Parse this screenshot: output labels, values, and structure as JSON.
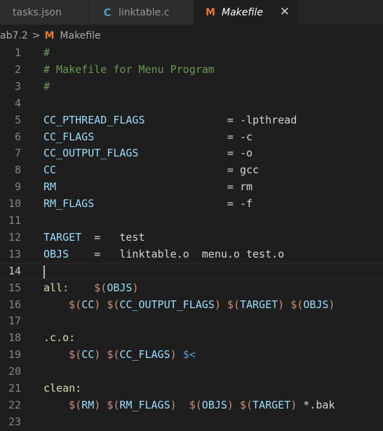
{
  "tabs": [
    {
      "label": "tasks.json",
      "icon": "json-file-icon"
    },
    {
      "label": "linktable.c",
      "icon": "c-file-icon",
      "icon_glyph": "C"
    },
    {
      "label": "Makefile",
      "icon": "makefile-icon",
      "icon_glyph": "M",
      "active": true
    }
  ],
  "breadcrumb": {
    "folder": "ab7.2",
    "separator": ">",
    "file_icon_glyph": "M",
    "file": "Makefile"
  },
  "colors": {
    "background": "#1e1e1e",
    "comment": "#6a9955",
    "variable": "#9cdcfe",
    "sigil": "#ce9178",
    "makefile_icon": "#e37933",
    "c_icon": "#519aba"
  },
  "editor": {
    "current_line": 14,
    "lines": [
      {
        "n": "1",
        "t": "#"
      },
      {
        "n": "2",
        "t": "# Makefile for Menu Program"
      },
      {
        "n": "3",
        "t": "#"
      },
      {
        "n": "4",
        "t": ""
      },
      {
        "n": "5",
        "t": "CC_PTHREAD_FLAGS             = -lpthread"
      },
      {
        "n": "6",
        "t": "CC_FLAGS                     = -c"
      },
      {
        "n": "7",
        "t": "CC_OUTPUT_FLAGS              = -o"
      },
      {
        "n": "8",
        "t": "CC                           = gcc"
      },
      {
        "n": "9",
        "t": "RM                           = rm"
      },
      {
        "n": "10",
        "t": "RM_FLAGS                     = -f"
      },
      {
        "n": "11",
        "t": ""
      },
      {
        "n": "12",
        "t": "TARGET  =   test"
      },
      {
        "n": "13",
        "t": "OBJS    =   linktable.o  menu.o test.o"
      },
      {
        "n": "14",
        "t": ""
      },
      {
        "n": "15",
        "t": "all:    $(OBJS)"
      },
      {
        "n": "16",
        "t": "    $(CC) $(CC_OUTPUT_FLAGS) $(TARGET) $(OBJS)"
      },
      {
        "n": "17",
        "t": ""
      },
      {
        "n": "18",
        "t": ".c.o:"
      },
      {
        "n": "19",
        "t": "    $(CC) $(CC_FLAGS) $<"
      },
      {
        "n": "20",
        "t": ""
      },
      {
        "n": "21",
        "t": "clean:"
      },
      {
        "n": "22",
        "t": "    $(RM) $(RM_FLAGS)  $(OBJS) $(TARGET) *.bak"
      },
      {
        "n": "23",
        "t": ""
      }
    ]
  }
}
